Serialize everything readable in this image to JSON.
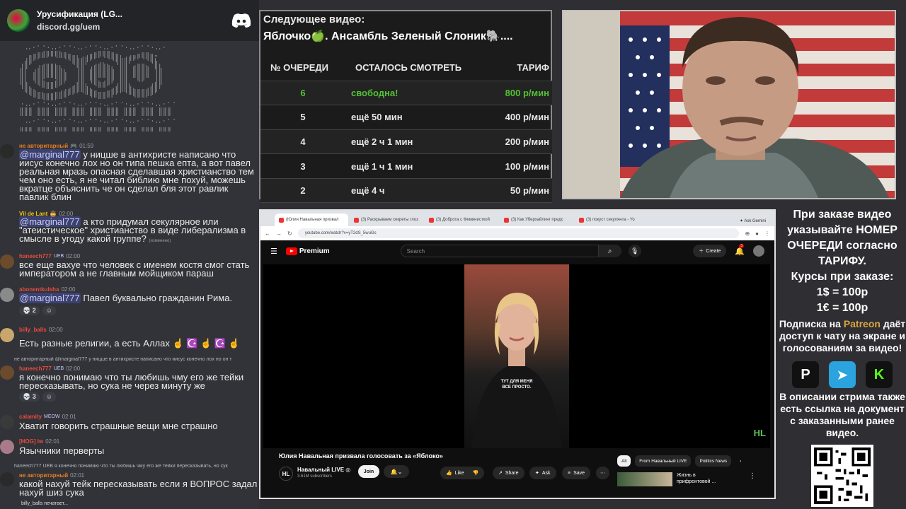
{
  "discord": {
    "server_name": "Урусификация (LG...",
    "server_link": "discord.gg/uem",
    "messages": [
      {
        "user": "не авторитарный",
        "time": "01:59",
        "mention": "@marginal777",
        "text": " у ницше в антихристе написано что иисус конечно лох но он типа пешка епта, а вот павел реальная мразь опасная сделавшая христианство тем чем оно есть, я не читал библию мне похуй, можешь вкратце объяснить че он сделал бля этот равлик павлик блин",
        "name_color": "#e67e22"
      },
      {
        "user": "Vil de Lant",
        "time": "02:00",
        "mention": "@marginal777",
        "text": " а кто придумал секулярное или \"атеистическое\" христианство в виде либерализма в смысле в угоду какой группе?",
        "edited": "(изменено)",
        "name_color": "#f1c40f"
      },
      {
        "user": "haneech777",
        "badge": "UEB",
        "time": "02:00",
        "text": "все еще вахуе что человек с именем костя смог стать императором а не главным мойщиком параш",
        "name_color": "#e74c3c"
      },
      {
        "user": "abonentkulsha",
        "time": "02:00",
        "mention": "@marginal777",
        "text": " Павел буквально гражданин Рима.",
        "reactions": [
          "2",
          ""
        ],
        "name_color": "#e74c3c"
      },
      {
        "user": "billy_balls",
        "time": "02:00",
        "text": "Есть разные религии, а есть Аллах ☝️ ☪️ ☝️ ☪️ ☝️",
        "name_color": "#e74c3c"
      },
      {
        "reply": "не авторитарный @marginal777 у ницше в антихристе написано что иисус конечно лох но он т",
        "user": "haneech777",
        "badge": "UEB",
        "time": "02:00",
        "text": "я конечно понимаю что ты любишь чму его же тейки пересказывать, но сука не через минуту же",
        "reactions": [
          "3",
          ""
        ],
        "name_color": "#e74c3c"
      },
      {
        "user": "calamity",
        "badge": "MEOW",
        "time": "02:01",
        "text": "Хватит говорить страшные вещи мне страшно",
        "name_color": "#e74c3c"
      },
      {
        "user": "[HOG] Iw",
        "time": "02:01",
        "text": "Язычники перверты",
        "name_color": "#e74c3c"
      },
      {
        "reply": "haneech777 UEB я конечно понимаю что ты любишь чму его же тейки пересказывать, но сук",
        "user": "не авторитарный",
        "time": "02:01",
        "text": "какой нахуй тейк пересказывать если я ВОПРОС задал нахуй шиз сука",
        "name_color": "#e67e22"
      }
    ],
    "typing": "billy_balls печатает..."
  },
  "queue": {
    "next_label": "Следующее видео:",
    "next_title": "Яблочко🍏. Ансамбль Зеленый Слоник🐘....",
    "headers": [
      "№ ОЧЕРЕДИ",
      "ОСТАЛОСЬ СМОТРЕТЬ",
      "ТАРИФ"
    ],
    "rows": [
      {
        "n": "6",
        "left": "свободна!",
        "rate": "800 р/мин",
        "free": true
      },
      {
        "n": "5",
        "left": "ещё 50 мин",
        "rate": "400 р/мин"
      },
      {
        "n": "4",
        "left": "ещё 2 ч 1 мин",
        "rate": "200 р/мин"
      },
      {
        "n": "3",
        "left": "ещё 1 ч 1 мин",
        "rate": "100 р/мин"
      },
      {
        "n": "2",
        "left": "ещё 4 ч",
        "rate": "50 р/мин"
      }
    ]
  },
  "browser": {
    "tabs": [
      "(Юлия Навальная призвал",
      "(3) Раскрываем секреты глоз",
      "(3) Доброта с Феминисткой",
      "(3) Как Уберхайлинг предс",
      "(3) покуст секулянта - Yo"
    ],
    "ask_gemini": "Ask Gemini",
    "url": "youtube.com/watch?v=yT2dS_5wuGs",
    "brand": "Premium",
    "search_placeholder": "Search",
    "create": "Create",
    "bell_count": "3",
    "caption": "ТУТ ДЛЯ МЕНЯ\nВСЕ ПРОСТО.",
    "watermark": "HL",
    "video_title": "Юлия Навальная призвала голосовать за «Яблоко»",
    "channel_logo": "HL",
    "channel_name": "Навальный LIVE ◎",
    "subscribers": "3.61M subscribers",
    "join": "Join",
    "like": "Like",
    "share": "Share",
    "ask": "Ask",
    "save": "Save",
    "chips": [
      "All",
      "From Навальный LIVE",
      "Politics News"
    ],
    "rec_title": "Жизнь в\nприфронтовой ..."
  },
  "info": {
    "order_lines": [
      "При заказе видео",
      "указывайте НОМЕР",
      "ОЧЕРЕДИ согласно",
      "ТАРИФУ.",
      "Курсы при заказе:",
      "1$ = 100р",
      "1€ = 100р"
    ],
    "sub_pre": "Подписка на ",
    "sub_brand": "Patreon",
    "sub_post": " даёт доступ к чату на экране и голосованиям за видео!",
    "desc": "В описании стрима также есть ссылка на документ с заказанными ранее видео."
  },
  "colors": {
    "free": "#52c234",
    "patreon_text": "#d9a441",
    "telegram": "#2aa3df",
    "kick": "#53fc18"
  }
}
